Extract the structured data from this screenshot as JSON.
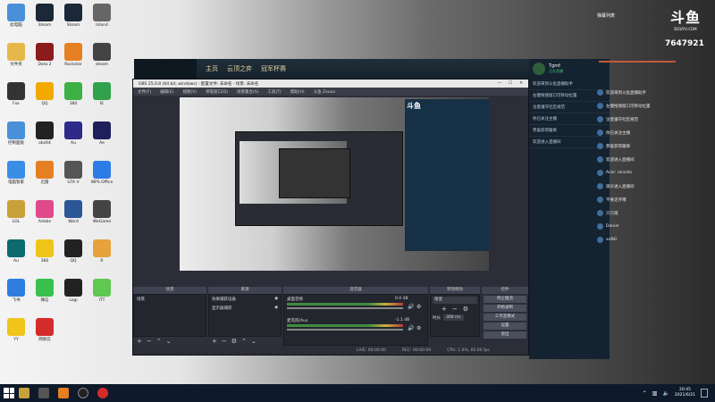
{
  "desktop_icons": [
    {
      "label": "此电脑",
      "color": "#4a90d9"
    },
    {
      "label": "Steam",
      "color": "#1b2838"
    },
    {
      "label": "Steam",
      "color": "#1b2838"
    },
    {
      "label": "Island",
      "color": "#666"
    },
    {
      "label": "文件夹",
      "color": "#e6b84a"
    },
    {
      "label": "Dota 2",
      "color": "#8b1c1c"
    },
    {
      "label": "Rockstar",
      "color": "#e67e22"
    },
    {
      "label": "steam",
      "color": "#444"
    },
    {
      "label": "Fox",
      "color": "#333"
    },
    {
      "label": "QQ",
      "color": "#f2a900"
    },
    {
      "label": "360",
      "color": "#3cb043"
    },
    {
      "label": "IE",
      "color": "#31a14c"
    },
    {
      "label": "控制面板",
      "color": "#4a90d9"
    },
    {
      "label": "obs64",
      "color": "#222"
    },
    {
      "label": "Au",
      "color": "#2d2a8a"
    },
    {
      "label": "Ae",
      "color": "#1f1f5b"
    },
    {
      "label": "电脑管家",
      "color": "#3a8ee6"
    },
    {
      "label": "迅雷",
      "color": "#e67e22"
    },
    {
      "label": "GTA V",
      "color": "#555"
    },
    {
      "label": "WPS Office",
      "color": "#2d7be5"
    },
    {
      "label": "LOL",
      "color": "#c9a13b"
    },
    {
      "label": "Adobe",
      "color": "#e04a8a"
    },
    {
      "label": "Word",
      "color": "#2b5797"
    },
    {
      "label": "WeGame",
      "color": "#444"
    },
    {
      "label": "Au",
      "color": "#0d6b6b"
    },
    {
      "label": "360",
      "color": "#f0c419"
    },
    {
      "label": "QQ",
      "color": "#222"
    },
    {
      "label": "R",
      "color": "#e6a23c"
    },
    {
      "label": "飞书",
      "color": "#2f7de1"
    },
    {
      "label": "微信",
      "color": "#38c14a"
    },
    {
      "label": "Logi",
      "color": "#222"
    },
    {
      "label": "ITT",
      "color": "#5ec850"
    },
    {
      "label": "YY",
      "color": "#f0c419"
    },
    {
      "label": "网易云",
      "color": "#d42b2b"
    }
  ],
  "douyu": {
    "logo_text": "斗鱼",
    "logo_sub": "DOUYU.COM",
    "follower_count": "7647921",
    "nav": [
      "主页",
      "云顶之弈",
      "冠军杯赛"
    ],
    "user": "Tgmf",
    "level": "正在直播"
  },
  "obs": {
    "title": "OBS 25.0.8 (64 bit, windows) - 配置文件: 未命名 - 场景: 未命名",
    "menu": [
      "文件(F)",
      "编辑(E)",
      "视图(V)",
      "停靠窗口(D)",
      "场景集合(S)",
      "工具(T)",
      "帮助(H)",
      "斗鱼 Zoooo"
    ],
    "docks": {
      "scenes": "场景",
      "sources": "来源",
      "mixer": "混音器",
      "transitions": "转场特效",
      "controls": "控件"
    },
    "scene_items": [
      "场景"
    ],
    "source_items": [
      "效果捕获设备",
      "显示器捕获"
    ],
    "mixer_channels": [
      {
        "name": "桌面音频",
        "db": "0.0 dB"
      },
      {
        "name": "麦克风/Aux",
        "db": "-1.1 dB"
      }
    ],
    "transition": {
      "label": "渐变",
      "duration_label": "时长",
      "duration": "300 ms"
    },
    "control_buttons": [
      "停止推流",
      "开始录制",
      "工作室模式",
      "设置",
      "退出"
    ],
    "status": {
      "live": "LIVE: 00:00:00",
      "rec": "REC: 00:00:00",
      "cpu": "CPU: 1.6%, 60.00 fps"
    }
  },
  "chat": {
    "header": "弹幕列表",
    "rank": "7647921",
    "messages": [
      "欢迎来到斗鱼直播助手",
      "左键拖拽窗口可移动位置",
      "注意遵守社区规范",
      "你已关注主播",
      "恭喜获得徽章",
      "欢迎进入直播间",
      "Acer: iancolo",
      "观众进入直播间",
      "不要走开哦",
      "只只观",
      "Danier",
      "xxNG"
    ]
  },
  "taskbar": {
    "time": "20:45",
    "date": "2021/6/21"
  }
}
